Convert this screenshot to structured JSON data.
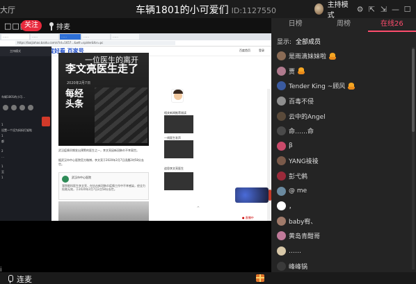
{
  "titlebar": {
    "left_text": "大厅",
    "room_title": "车辆1801的小可爱们",
    "room_id": "ID:1127550",
    "host_mode": "主持模式",
    "icons": [
      "gear-icon",
      "share-icon",
      "popout-icon",
      "minimize-icon",
      "maximize-icon",
      "close-icon"
    ],
    "icon_glyphs": {
      "gear": "⚙",
      "share": "⇱",
      "popout": "⇲",
      "minimize": "—",
      "maximize": "☐",
      "close": "✕"
    }
  },
  "subbar": {
    "squares": "□□□",
    "follow_label": "关注",
    "sort_label": "排麦"
  },
  "screen": {
    "tabs": [
      "……",
      "……",
      "……",
      "……",
      "……"
    ],
    "url": "https://baijiahao.baidu.com/s?id=1657…&wfr=spider&for=pc",
    "site_title": "百度好看 百家号",
    "site_links": [
      "百度首页",
      "登录"
    ],
    "left_panel_title": "主持模式",
    "left_panel_lines": [
      "车辆1801的小可…",
      "1",
      "设置一个设为妈妈打架啦",
      "1",
      "都",
      "2",
      "…",
      "1",
      "至",
      "1"
    ],
    "article_top": "一位医生的离开",
    "article_headline": "李文亮医生走了",
    "article_date": "2020年2月7日",
    "article_brand_1": "每经",
    "article_brand_2": "头条",
    "article_para_1": "武汉疫情早期发出预警的医生之一，李文亮因新冠肺炎不幸离世。",
    "article_para_2": "据武汉市中心医院官方微博，李文亮于2020年2月7日凌晨2时58分去世。",
    "embed_name": "武汉市中心医院",
    "embed_body": "我院眼科医生李文亮，在抗击新冠肺炎疫情工作中不幸感染，经全力抢救无效，于2020年2月7日2点58分去世。",
    "side_items": [
      "相关新闻推荐阅读",
      "一线医生发声",
      "追思李文亮医生"
    ],
    "live_indicator": "● 直播中"
  },
  "bottombar": {
    "mic_label": "连麦",
    "tip": "i"
  },
  "right_panel": {
    "tabs": [
      "日榜",
      "周榜",
      "在线26"
    ],
    "active_tab": 2,
    "filter_label": "显示:",
    "filter_value": "全部成员",
    "members": [
      {
        "name": "是雨滴妹妹啦",
        "badge": true,
        "avatar": "#8a6b55"
      },
      {
        "name": "贾",
        "badge": true,
        "avatar": "#b07a8e"
      },
      {
        "name": "Tender King ~顾风",
        "badge": true,
        "avatar": "#3a5aa0"
      },
      {
        "name": "百毒不侵",
        "badge": false,
        "avatar": "#8f8f8f"
      },
      {
        "name": "云中的Angel",
        "badge": false,
        "avatar": "#5a4a3a"
      },
      {
        "name": "命……命",
        "badge": false,
        "avatar": "#4a4a4a"
      },
      {
        "name": "β",
        "badge": false,
        "avatar": "#c94a6a"
      },
      {
        "name": "YANG祾祾",
        "badge": false,
        "avatar": "#7a5a4a"
      },
      {
        "name": "彭弋鸺",
        "badge": false,
        "avatar": "#9a2a3a"
      },
      {
        "name": "@ me",
        "badge": false,
        "avatar": "#6a8aa0"
      },
      {
        "name": "，",
        "badge": false,
        "avatar": "#ffffff"
      },
      {
        "name": "baby宥、",
        "badge": false,
        "avatar": "#a07a6a"
      },
      {
        "name": "黄岛青酣哥",
        "badge": false,
        "avatar": "#c07a9a"
      },
      {
        "name": "……",
        "badge": false,
        "avatar": "#d8c8a8"
      },
      {
        "name": "峰峰锅",
        "badge": false,
        "avatar": "#3a3a3a"
      }
    ]
  }
}
